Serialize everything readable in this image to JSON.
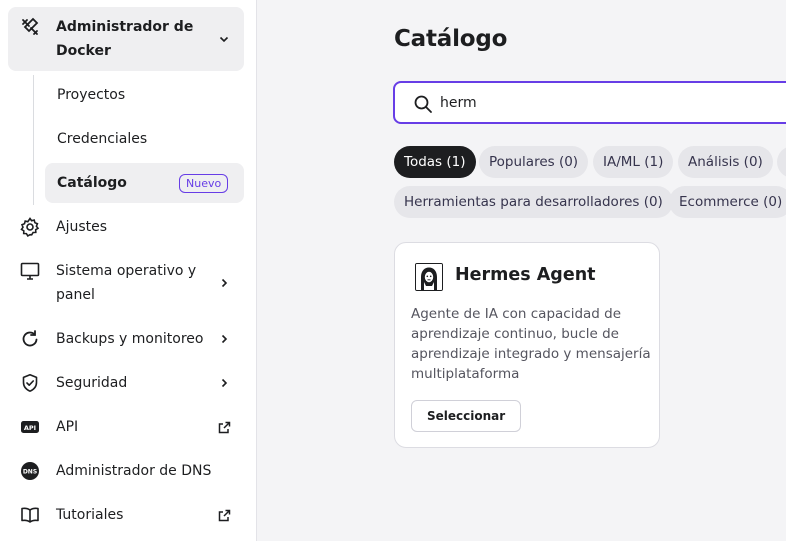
{
  "sidebar": {
    "docker_group": {
      "label_line1": "Administrador de",
      "label_line2": "Docker",
      "icon": "docker-manager-icon"
    },
    "sub_items": [
      {
        "label": "Proyectos"
      },
      {
        "label": "Credenciales"
      },
      {
        "label": "Catálogo",
        "badge": "Nuevo",
        "active": true
      }
    ],
    "items": [
      {
        "label": "Ajustes",
        "icon": "gear-icon"
      },
      {
        "label_line1": "Sistema operativo y",
        "label_line2": "panel",
        "icon": "monitor-icon"
      },
      {
        "label": "Backups y monitoreo",
        "icon": "refresh-icon"
      },
      {
        "label": "Seguridad",
        "icon": "shield-icon"
      },
      {
        "label": "API",
        "icon": "api-icon"
      },
      {
        "label": "Administrador de DNS",
        "icon": "dns-icon"
      },
      {
        "label": "Tutoriales",
        "icon": "book-icon"
      }
    ]
  },
  "main": {
    "title": "Catálogo",
    "search": {
      "value": "herm"
    },
    "filters": [
      {
        "label": "Todas (1)",
        "active": true
      },
      {
        "label": "Populares (0)"
      },
      {
        "label": "IA/ML (1)"
      },
      {
        "label": "Análisis (0)"
      },
      {
        "label": "Herramientas para desarrolladores (0)"
      },
      {
        "label": "Ecommerce (0)"
      }
    ],
    "card": {
      "title": "Hermes Agent",
      "description": "Agente de IA con capacidad de aprendizaje continuo, bucle de aprendizaje integrado y mensajería multiplataforma",
      "button": "Seleccionar"
    }
  },
  "colors": {
    "accent": "#673de6",
    "active_chip": "#1d1e20",
    "text": "#1d1e20"
  }
}
